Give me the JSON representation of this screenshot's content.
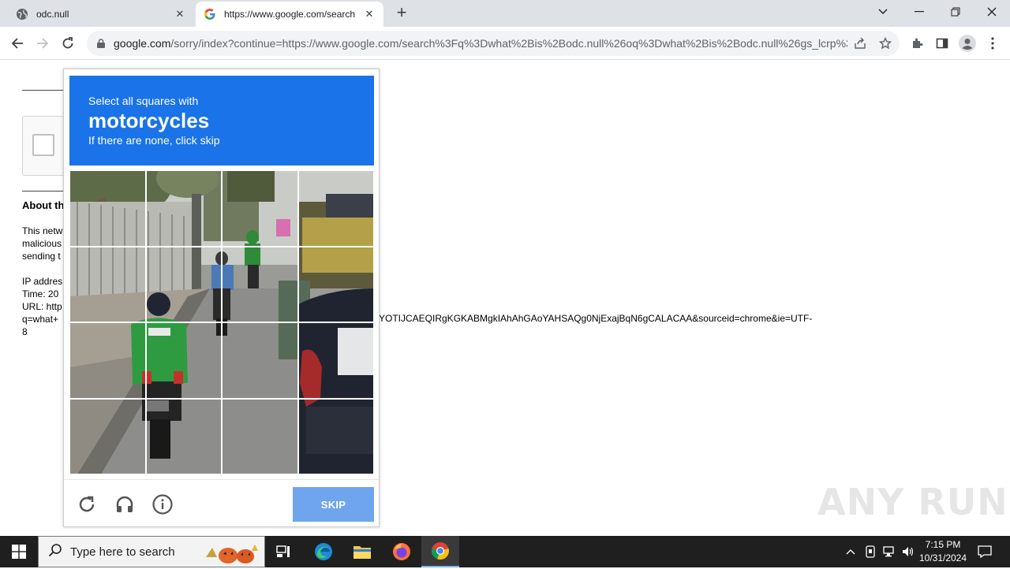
{
  "browser": {
    "tabs": [
      {
        "title": "odc.null",
        "icon": "globe-icon"
      },
      {
        "title": "https://www.google.com/search",
        "icon": "google-icon"
      }
    ],
    "new_tab_label": "+",
    "address": {
      "domain": "google.com",
      "path": "/sorry/index?continue=https://www.google.com/search%3Fq%3Dwhat%2Bis%2Bodc.null%26oq%3Dwhat%2Bis%2Bodc.null%26gs_lcrp%3D..."
    }
  },
  "page": {
    "about_heading": "About th",
    "para_lines": [
      "This netw",
      "malicious",
      "sending t"
    ],
    "info_lines": [
      "IP addres",
      "Time: 20",
      "URL: http",
      "q=what+",
      "8"
    ],
    "url_tail": "YOTIJCAEQIRgKGKABMgkIAhAhGAoYAHSAQg0NjExajBqN6gCALACAA&sourceid=chrome&ie=UTF-"
  },
  "captcha": {
    "instruction_line1": "Select all squares with",
    "target_object": "motorcycles",
    "instruction_line3": "If there are none, click skip",
    "skip_label": "SKIP",
    "header_color": "#1a73e8",
    "grid_size": 4
  },
  "watermark": "ANY RUN",
  "taskbar": {
    "search_placeholder": "Type here to search",
    "time": "7:15 PM",
    "date": "10/31/2024"
  }
}
